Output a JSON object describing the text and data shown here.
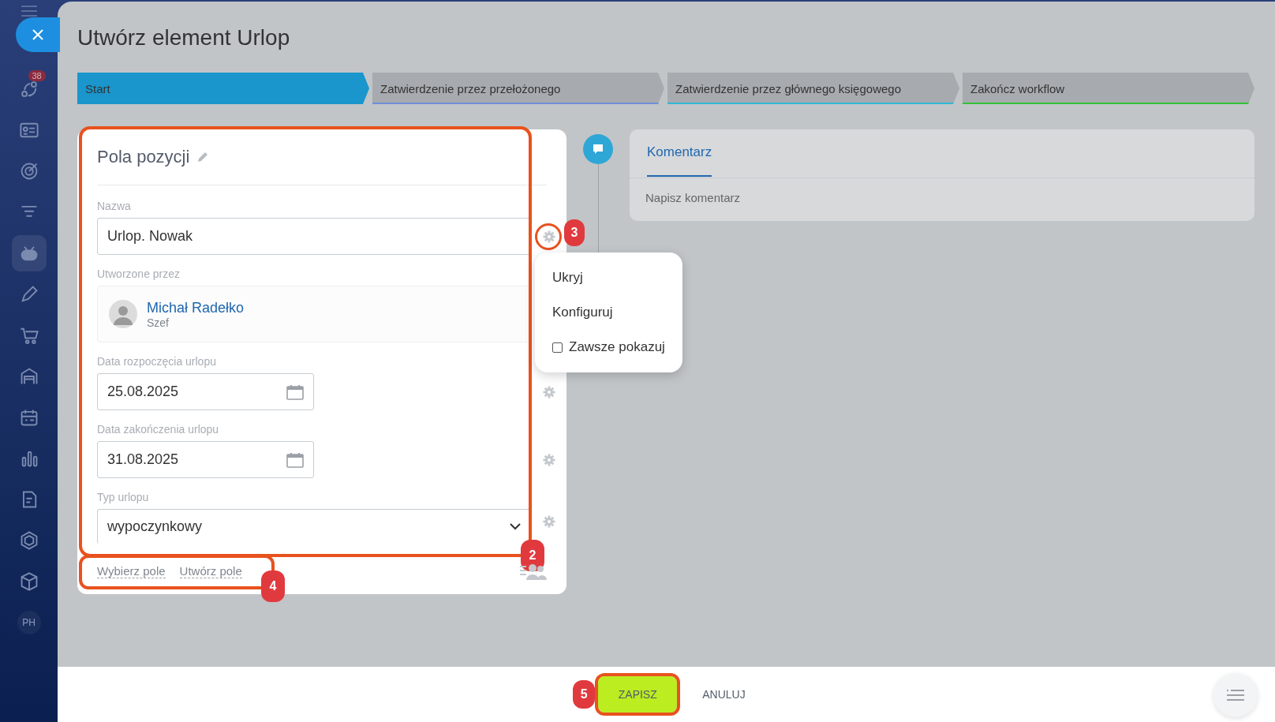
{
  "sidebar": {
    "items": [
      {
        "kind": "icon",
        "selected": false,
        "badge": "38"
      },
      {
        "kind": "icon",
        "selected": false
      },
      {
        "kind": "icon",
        "selected": false
      },
      {
        "kind": "icon",
        "selected": false
      },
      {
        "kind": "icon",
        "selected": true
      },
      {
        "kind": "icon",
        "selected": false
      },
      {
        "kind": "icon",
        "selected": false
      },
      {
        "kind": "icon",
        "selected": false
      },
      {
        "kind": "icon",
        "selected": false
      },
      {
        "kind": "icon",
        "selected": false
      },
      {
        "kind": "icon",
        "selected": false
      },
      {
        "kind": "icon",
        "selected": false
      },
      {
        "kind": "icon",
        "selected": false
      },
      {
        "kind": "text",
        "label": "PH",
        "selected": false
      }
    ]
  },
  "window": {
    "title": "Utwórz element Urlop"
  },
  "steps": [
    {
      "label": "Start",
      "selected": true,
      "color": "#1a96cd"
    },
    {
      "label": "Zatwierdzenie przez przełożonego",
      "selected": false,
      "color": "#6f8fd8"
    },
    {
      "label": "Zatwierdzenie przez głównego księgowego",
      "selected": false,
      "color": "#2fb8d6"
    },
    {
      "label": "Zakończ workflow",
      "selected": false,
      "color": "#35c236"
    }
  ],
  "card": {
    "title": "Pola pozycji",
    "fields": [
      {
        "kind": "text",
        "label": "Nazwa",
        "value": "Urlop. Nowak"
      },
      {
        "kind": "user",
        "label": "Utworzone przez",
        "name": "Michał Radełko",
        "role": "Szef"
      },
      {
        "kind": "date",
        "label": "Data rozpoczęcia urlopu",
        "value": "25.08.2025"
      },
      {
        "kind": "date",
        "label": "Data zakończenia urlopu",
        "value": "31.08.2025"
      },
      {
        "kind": "select",
        "label": "Typ urlopu",
        "value": "wypoczynkowy"
      }
    ],
    "links": [
      "Wybierz pole",
      "Utwórz pole"
    ],
    "menu": [
      {
        "kind": "item",
        "label": "Ukryj"
      },
      {
        "kind": "item",
        "label": "Konfiguruj"
      },
      {
        "kind": "checkbox",
        "label": "Zawsze pokazuj",
        "checked": false
      }
    ]
  },
  "comments": {
    "tab": "Komentarz",
    "placeholder": "Napisz komentarz"
  },
  "buttons": [
    {
      "kind": "primary",
      "label": "ZAPISZ"
    },
    {
      "kind": "link",
      "label": "ANULUJ"
    }
  ],
  "annotations": [
    {
      "label": "2"
    },
    {
      "label": "3"
    },
    {
      "label": "4"
    },
    {
      "label": "5"
    }
  ]
}
